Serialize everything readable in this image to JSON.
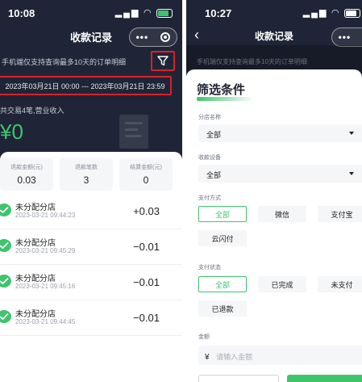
{
  "left": {
    "status": {
      "time": "10:08"
    },
    "nav": {
      "title": "收款记录"
    },
    "hint": "手机端仅支持查询最多10天的订单明细",
    "date_range": "2023年03月21日 00:00 --- 2023年03月21日 23:59",
    "summary": "共交易4笔,营业收入",
    "amount": "¥0",
    "stats": [
      {
        "label": "退款金额(元)",
        "value": "0.03"
      },
      {
        "label": "退款笔数",
        "value": "3"
      },
      {
        "label": "结算金额(元)",
        "value": "0"
      }
    ],
    "records": [
      {
        "name": "未分配分店",
        "time": "2023-03-21 09:44:23",
        "amount": "+0.03"
      },
      {
        "name": "未分配分店",
        "time": "2023-03-21 09:45:29",
        "amount": "−0.01"
      },
      {
        "name": "未分配分店",
        "time": "2023-03-21 09:45:16",
        "amount": "−0.01"
      },
      {
        "name": "未分配分店",
        "time": "2023-03-21 09:44:45",
        "amount": "−0.01"
      }
    ]
  },
  "right": {
    "status": {
      "time": "10:27"
    },
    "nav": {
      "title": "收款记录"
    },
    "hint": "手机端仅支持查询最多10天的订单明细",
    "sheet": {
      "title": "筛选条件",
      "store": {
        "label": "分店名称",
        "value": "全部"
      },
      "device": {
        "label": "收款设备",
        "value": "全部"
      },
      "pay_method": {
        "label": "支付方式",
        "options": [
          "全部",
          "微信",
          "支付宝",
          "云闪付"
        ],
        "selected": "全部"
      },
      "pay_status": {
        "label": "支付状态",
        "options": [
          "全部",
          "已完成",
          "未支付",
          "已退款"
        ],
        "selected": "全部"
      },
      "amount": {
        "label": "金额",
        "currency": "¥",
        "placeholder": "请输入金额"
      }
    }
  },
  "colors": {
    "accent": "#3ec46d",
    "highlight": "#d9202a",
    "header_bg": "#1f2536"
  }
}
